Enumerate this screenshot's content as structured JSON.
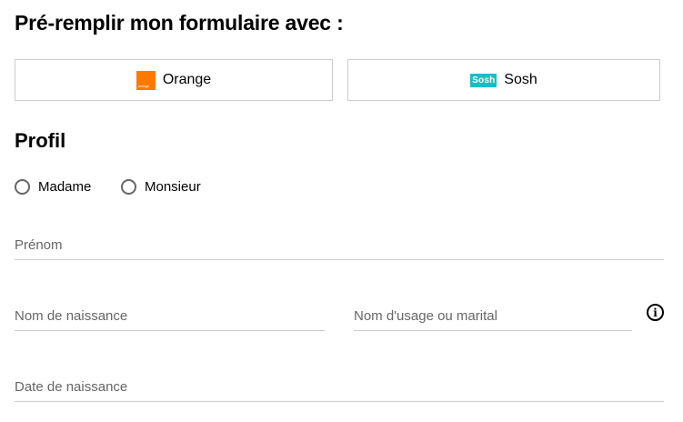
{
  "prefill": {
    "title": "Pré-remplir mon formulaire avec :",
    "orange_label": "Orange",
    "orange_logo_text": "orange",
    "orange_icon": "orange-logo-icon",
    "sosh_label": "Sosh",
    "sosh_logo_text": "Sosh",
    "sosh_icon": "sosh-logo-icon"
  },
  "profile": {
    "title": "Profil",
    "civility_options": [
      "Madame",
      "Monsieur"
    ],
    "fields": {
      "prenom_placeholder": "Prénom",
      "nom_naissance_placeholder": "Nom de naissance",
      "nom_usage_placeholder": "Nom d'usage ou marital",
      "date_naissance_placeholder": "Date de naissance"
    },
    "info_icon": "info-icon"
  },
  "colors": {
    "orange_brand": "#ff7900",
    "sosh_brand": "#1bbcc4",
    "border": "#cccccc",
    "placeholder": "#666666"
  }
}
